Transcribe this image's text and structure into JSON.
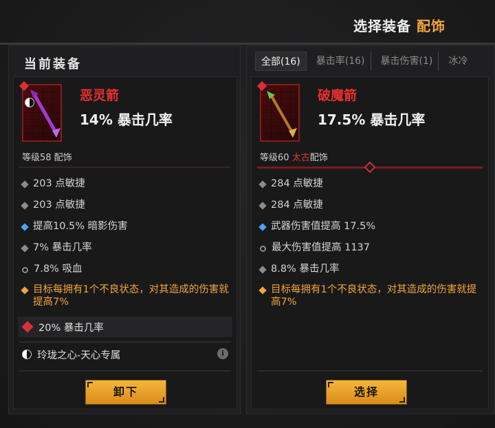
{
  "header": {
    "title_main": "选择装备 ",
    "title_accent": "配饰"
  },
  "left": {
    "title": "当前装备",
    "item": {
      "name": "恶灵箭",
      "main_stat": "14% 暴击几率",
      "level_text": "等级58 配饰",
      "icon": "purple-arrow-icon"
    },
    "stats": [
      {
        "bullet": "gray",
        "text": "203 点敏捷"
      },
      {
        "bullet": "gray",
        "text": "203 点敏捷"
      },
      {
        "bullet": "blue",
        "text": "提高10.5% 暗影伤害"
      },
      {
        "bullet": "gray",
        "text": "7% 暴击几率"
      },
      {
        "bullet": "ring",
        "text": "7.8% 吸血"
      },
      {
        "bullet": "orange",
        "text": "目标每拥有1个不良状态，对其造成的伤害就提高7%"
      }
    ],
    "socket": {
      "text": "20% 暴击几率",
      "icon": "ruby-gem-icon"
    },
    "set": {
      "text": "玲珑之心-天心专属",
      "icon": "yinyang-icon",
      "info": "i"
    },
    "button_label": "卸下"
  },
  "right": {
    "tabs": [
      {
        "label": "全部(16)",
        "active": true
      },
      {
        "label": "暴击率(16)",
        "active": false
      },
      {
        "label": "暴击伤害(1)",
        "active": false
      },
      {
        "label": "冰冷",
        "active": false
      }
    ],
    "item": {
      "name": "破魔箭",
      "main_stat": "17.5% 暴击几率",
      "level_prefix": "等级60 ",
      "level_ancient": "太古",
      "level_suffix": "配饰",
      "icon": "green-arrow-icon"
    },
    "stats": [
      {
        "bullet": "gray",
        "text": "284 点敏捷"
      },
      {
        "bullet": "gray",
        "text": "284 点敏捷"
      },
      {
        "bullet": "blue",
        "text": "武器伤害值提高 17.5%"
      },
      {
        "bullet": "ring",
        "text": "最大伤害值提高 1137"
      },
      {
        "bullet": "gray",
        "text": "8.8% 暴击几率"
      },
      {
        "bullet": "orange",
        "text": "目标每拥有1个不良状态，对其造成的伤害就提高7%"
      }
    ],
    "button_label": "选择"
  },
  "colors": {
    "legendary": "#e8302c",
    "accent": "#f2a53b",
    "magic_blue": "#4aa3ff",
    "button": "#f5b73a"
  }
}
